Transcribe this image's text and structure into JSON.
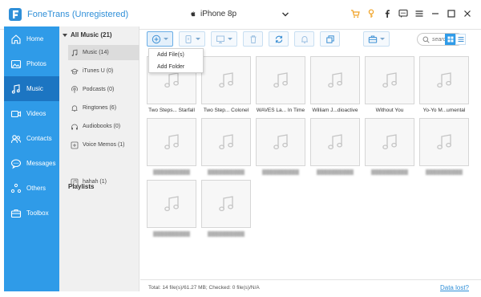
{
  "app": {
    "title": "FoneTrans (Unregistered)",
    "device": "iPhone 8p"
  },
  "colors": {
    "accent": "#2f9be8",
    "nav_active": "#1c75c2",
    "logo": "#2f8fd8",
    "cart": "#f0a020"
  },
  "window_buttons": [
    "cart-icon",
    "key-icon",
    "facebook-icon",
    "chat-icon",
    "menu-icon",
    "minimize-icon",
    "maximize-icon",
    "close-icon"
  ],
  "nav": {
    "items": [
      {
        "label": "Home",
        "icon": "home-icon"
      },
      {
        "label": "Photos",
        "icon": "photos-icon"
      },
      {
        "label": "Music",
        "icon": "music-icon",
        "active": true
      },
      {
        "label": "Videos",
        "icon": "videos-icon"
      },
      {
        "label": "Contacts",
        "icon": "contacts-icon"
      },
      {
        "label": "Messages",
        "icon": "messages-icon"
      },
      {
        "label": "Others",
        "icon": "others-icon"
      },
      {
        "label": "Toolbox",
        "icon": "toolbox-icon"
      }
    ]
  },
  "categories": {
    "header": "All Music (21)",
    "items": [
      {
        "label": "Music (14)",
        "icon": "music-note-icon",
        "selected": true
      },
      {
        "label": "iTunes U (0)",
        "icon": "itunes-u-icon"
      },
      {
        "label": "Podcasts (0)",
        "icon": "podcast-icon"
      },
      {
        "label": "Ringtones (6)",
        "icon": "bell-icon"
      },
      {
        "label": "Audiobooks (0)",
        "icon": "audiobook-icon"
      },
      {
        "label": "Voice Memos (1)",
        "icon": "voice-memo-icon"
      }
    ],
    "playlists_header": "Playlists",
    "playlists": [
      {
        "label": "hahah (1)",
        "icon": "playlist-icon"
      }
    ]
  },
  "toolbar": {
    "buttons": [
      "add-icon",
      "export-to-device-icon",
      "export-to-pc-icon",
      "delete-icon",
      "sync-icon",
      "ringtone-icon",
      "copy-icon",
      "toolbox-icon"
    ],
    "search_placeholder": "search"
  },
  "dropdown": {
    "items": [
      "Add File(s)",
      "Add Folder"
    ]
  },
  "tracks": [
    {
      "label": "Two Steps... Starfall"
    },
    {
      "label": "Two Step... Colonel"
    },
    {
      "label": "WAVES La... In Time"
    },
    {
      "label": "William J...dioactive"
    },
    {
      "label": "Without You"
    },
    {
      "label": "Yo-Yo M...umental"
    },
    {
      "label": "",
      "blurred": true
    },
    {
      "label": "",
      "blurred": true
    },
    {
      "label": "",
      "blurred": true
    },
    {
      "label": "",
      "blurred": true
    },
    {
      "label": "",
      "blurred": true
    },
    {
      "label": "",
      "blurred": true
    },
    {
      "label": "",
      "blurred": true
    },
    {
      "label": "",
      "blurred": true
    }
  ],
  "status": {
    "text": "Total: 14 file(s)/61.27 MB; Checked: 0 file(s)/N/A",
    "link": "Data lost?"
  }
}
